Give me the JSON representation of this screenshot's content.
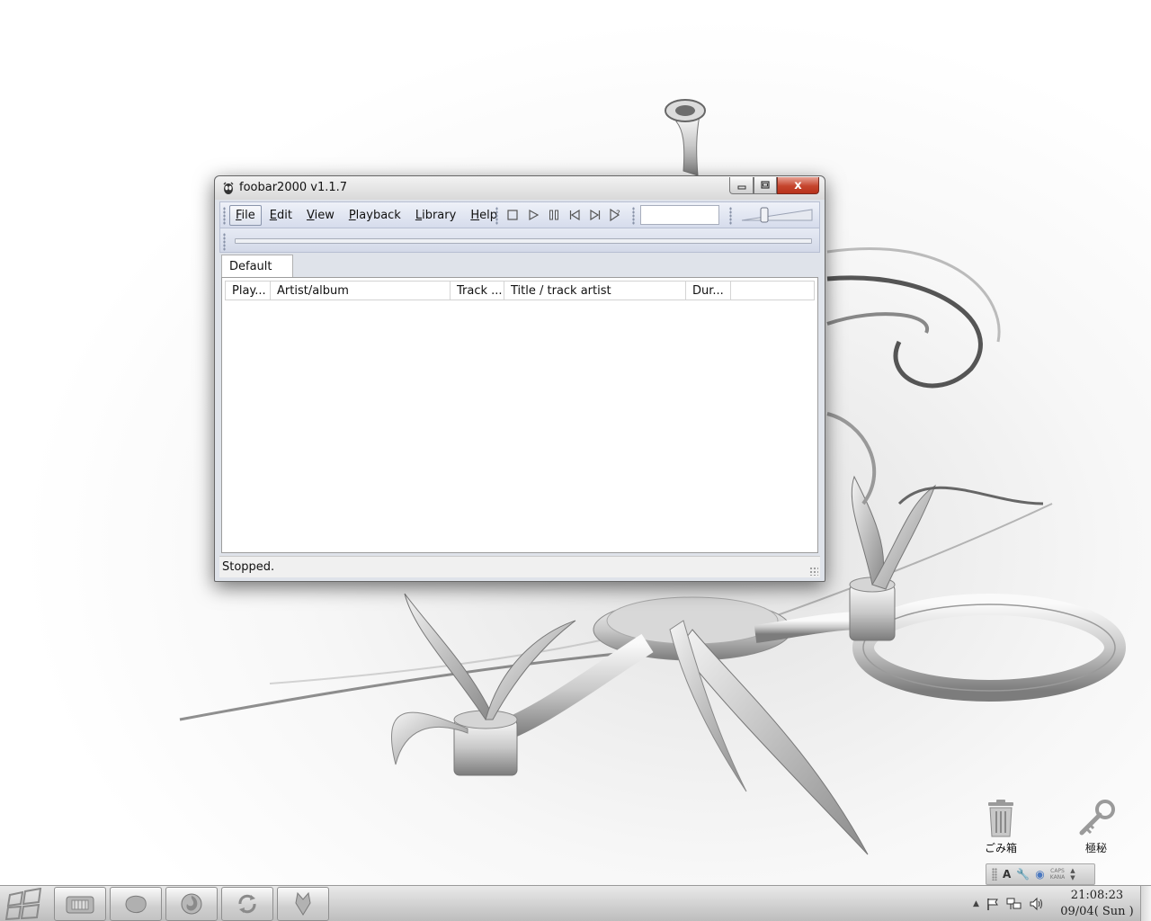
{
  "window": {
    "title": "foobar2000 v1.1.7",
    "close_label": "x",
    "menu": [
      {
        "label": "File",
        "accel": "F",
        "rest": "ile"
      },
      {
        "label": "Edit",
        "accel": "E",
        "rest": "dit"
      },
      {
        "label": "View",
        "accel": "V",
        "rest": "iew"
      },
      {
        "label": "Playback",
        "accel": "P",
        "rest": "layback"
      },
      {
        "label": "Library",
        "accel": "L",
        "rest": "ibrary"
      },
      {
        "label": "Help",
        "accel": "H",
        "rest": "elp"
      }
    ],
    "transport_icons": [
      "stop-icon",
      "play-icon",
      "pause-icon",
      "previous-icon",
      "next-icon",
      "random-icon"
    ],
    "volume_level": 0.3,
    "seek_position": 0,
    "tabs": [
      {
        "label": "Default"
      }
    ],
    "columns": [
      "Play...",
      "Artist/album",
      "Track ...",
      "Title / track artist",
      "Dur..."
    ],
    "status": "Stopped.",
    "colors": {
      "close_red": "#c5452d",
      "toolbar_blue": "#d6dcec"
    }
  },
  "desktop": {
    "icons": [
      {
        "label": "ごみ箱",
        "icon": "recycle-bin-icon"
      },
      {
        "label": "極秘",
        "icon": "key-icon"
      }
    ],
    "ime": {
      "mode": "A",
      "caps_label": "CAPS",
      "kana_label": "KANA"
    }
  },
  "taskbar": {
    "pinned": [
      "files-icon",
      "stone-icon",
      "firefox-icon",
      "sync-icon",
      "fox-icon"
    ],
    "clock_time": "21:08:23",
    "clock_date": "09/04( Sun )"
  }
}
